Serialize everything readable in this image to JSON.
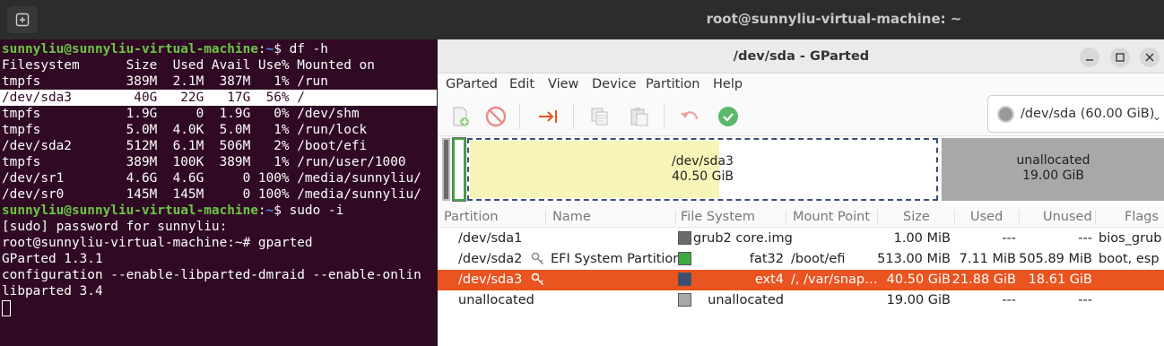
{
  "terminal": {
    "title": "root@sunnyliu-virtual-machine: ~",
    "lines": [
      {
        "user": "sunnyliu@sunnyliu-virtual-machine",
        "sep": ":",
        "path": "~",
        "cmd": "$ df -h"
      },
      {
        "text": "Filesystem      Size  Used Avail Use% Mounted on"
      },
      {
        "text": "tmpfs           389M  2.1M  387M   1% /run"
      },
      {
        "text": "/dev/sda3        40G   22G   17G  56% /"
      },
      {
        "text": "tmpfs           1.9G     0  1.9G   0% /dev/shm"
      },
      {
        "text": "tmpfs           5.0M  4.0K  5.0M   1% /run/lock"
      },
      {
        "text": "/dev/sda2       512M  6.1M  506M   2% /boot/efi"
      },
      {
        "text": "tmpfs           389M  100K  389M   1% /run/user/1000"
      },
      {
        "text": "/dev/sr1        4.6G  4.6G     0 100% /media/sunnyliu/"
      },
      {
        "text": "/dev/sr0        145M  145M     0 100% /media/sunnyliu/"
      },
      {
        "user": "sunnyliu@sunnyliu-virtual-machine",
        "sep": ":",
        "path": "~",
        "cmd": "$ sudo -i"
      },
      {
        "text": "[sudo] password for sunnyliu:"
      },
      {
        "text": "root@sunnyliu-virtual-machine:~# gparted"
      },
      {
        "text": "GParted 1.3.1"
      },
      {
        "text": "configuration --enable-libparted-dmraid --enable-onlin"
      },
      {
        "text": "libparted 3.4"
      }
    ]
  },
  "gparted": {
    "title": "/dev/sda - GParted",
    "menu": [
      "GParted",
      "Edit",
      "View",
      "Device",
      "Partition",
      "Help"
    ],
    "toolbar_icons": [
      "new-icon",
      "delete-icon",
      "resize-move-icon",
      "copy-icon",
      "paste-icon",
      "undo-icon",
      "apply-icon"
    ],
    "device": "/dev/sda (60.00 GiB)",
    "partition_bar": {
      "main_name": "/dev/sda3",
      "main_size": "40.50 GiB",
      "unalloc_name": "unallocated",
      "unalloc_size": "19.00 GiB"
    },
    "columns": [
      "Partition",
      "Name",
      "File System",
      "Mount Point",
      "Size",
      "Used",
      "Unused",
      "Flags"
    ],
    "rows": [
      {
        "partition": "/dev/sda1",
        "name": "",
        "fs": "grub2 core.img",
        "mount": "",
        "size": "1.00 MiB",
        "used": "---",
        "unused": "---",
        "flags": "bios_grub",
        "color": "#6b6b6b",
        "key": false
      },
      {
        "partition": "/dev/sda2",
        "name": "EFI System Partition",
        "fs": "fat32",
        "mount": "/boot/efi",
        "size": "513.00 MiB",
        "used": "7.11 MiB",
        "unused": "505.89 MiB",
        "flags": "boot, esp",
        "color": "#3fa83f",
        "key": true
      },
      {
        "partition": "/dev/sda3",
        "name": "",
        "fs": "ext4",
        "mount": "/, /var/snap…",
        "size": "40.50 GiB",
        "used": "21.88 GiB",
        "unused": "18.61 GiB",
        "flags": "",
        "color": "#3a4f72",
        "key": true
      },
      {
        "partition": "unallocated",
        "name": "",
        "fs": "unallocated",
        "mount": "",
        "size": "19.00 GiB",
        "used": "---",
        "unused": "---",
        "flags": "",
        "color": "#a8a8a8",
        "key": false
      }
    ],
    "selected_row": 2
  }
}
